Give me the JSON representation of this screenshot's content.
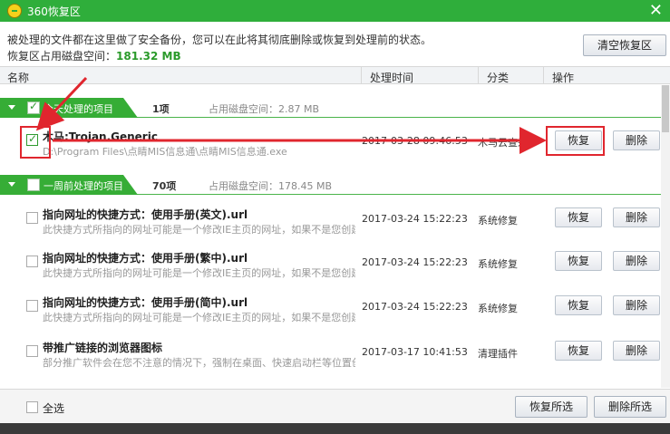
{
  "window": {
    "title": "360恢复区",
    "close_glyph": "✕"
  },
  "info": {
    "description": "被处理的文件都在这里做了安全备份，您可以在此将其彻底删除或恢复到处理前的状态。",
    "disk_label": "恢复区占用磁盘空间：",
    "disk_value": "181.32 MB",
    "clear_button": "清空恢复区"
  },
  "columns": {
    "name": "名称",
    "time": "处理时间",
    "category": "分类",
    "action": "操作"
  },
  "groups": [
    {
      "label": "今天处理的项目",
      "count": "1项",
      "disk": "占用磁盘空间：2.87 MB"
    },
    {
      "label": "一周前处理的项目",
      "count": "70项",
      "disk": "占用磁盘空间：178.45 MB"
    }
  ],
  "items": [
    {
      "name": "木马:Trojan.Generic",
      "desc": "D:\\Program Files\\点睛MIS信息通\\点睛MIS信息通.exe",
      "time": "2017-03-28 09:46:53",
      "category": "木马云查杀",
      "restore": "恢复",
      "delete": "删除"
    },
    {
      "name": "指向网址的快捷方式：使用手册(英文).url",
      "desc": "此快捷方式所指向的网址可能是一个修改IE主页的网址，如果不是您创建的...",
      "time": "2017-03-24 15:22:23",
      "category": "系统修复",
      "restore": "恢复",
      "delete": "删除"
    },
    {
      "name": "指向网址的快捷方式：使用手册(繁中).url",
      "desc": "此快捷方式所指向的网址可能是一个修改IE主页的网址，如果不是您创建的...",
      "time": "2017-03-24 15:22:23",
      "category": "系统修复",
      "restore": "恢复",
      "delete": "删除"
    },
    {
      "name": "指向网址的快捷方式：使用手册(简中).url",
      "desc": "此快捷方式所指向的网址可能是一个修改IE主页的网址，如果不是您创建的...",
      "time": "2017-03-24 15:22:23",
      "category": "系统修复",
      "restore": "恢复",
      "delete": "删除"
    },
    {
      "name": "带推广链接的浏览器图标",
      "desc": "部分推广软件会在您不注意的情况下，强制在桌面、快速启动栏等位置创建...",
      "time": "2017-03-17 10:41:53",
      "category": "清理插件",
      "restore": "恢复",
      "delete": "删除"
    }
  ],
  "footer": {
    "select_all": "全选",
    "restore_selected": "恢复所选",
    "delete_selected": "删除所选"
  },
  "colors": {
    "titlebar": "#2fae3b",
    "group_tab": "#36ad36",
    "annotation": "#e0262e",
    "disk_value": "#2a9a2a"
  }
}
